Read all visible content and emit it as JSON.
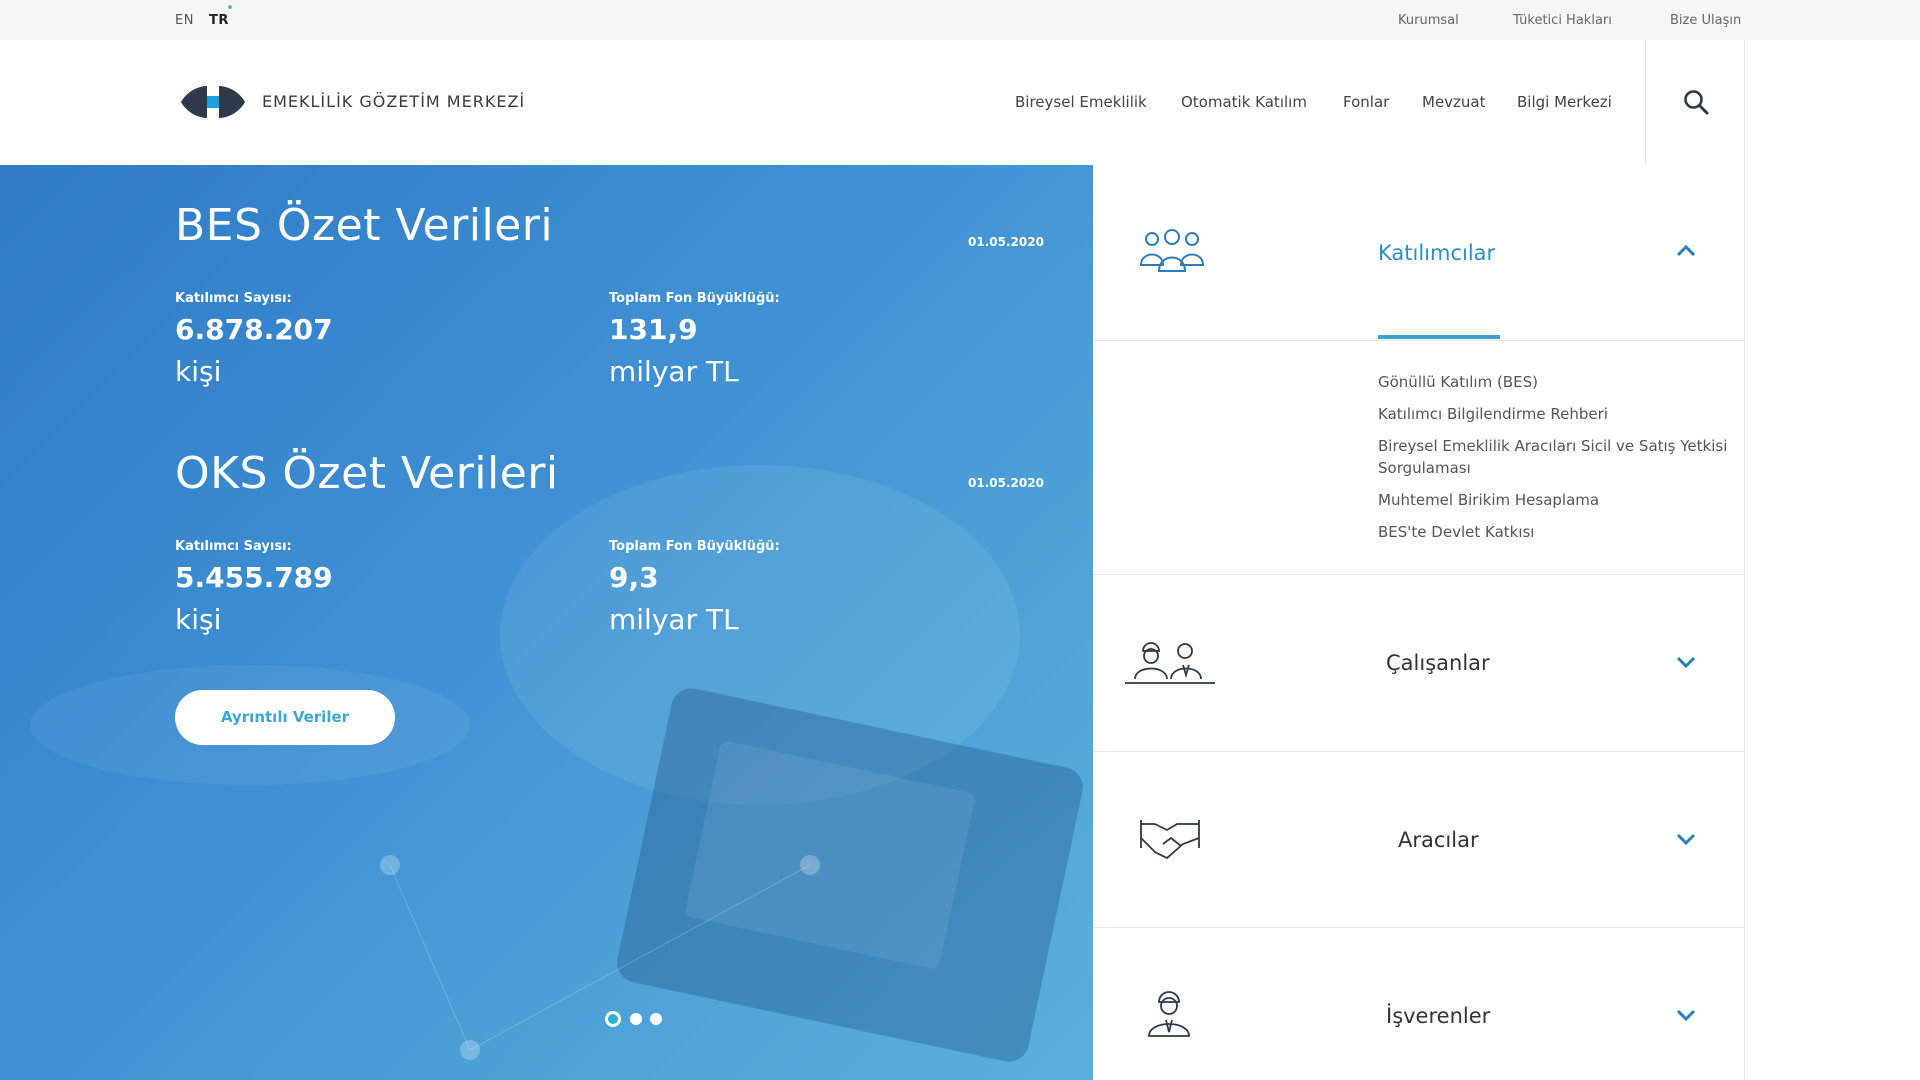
{
  "topbar": {
    "lang_en": "EN",
    "lang_tr": "TR",
    "links": [
      "Kurumsal",
      "Tüketici Hakları",
      "Bize Ulaşın"
    ]
  },
  "header": {
    "brand": "EMEKLİLİK GÖZETİM MERKEZİ",
    "nav": [
      "Bireysel Emeklilik",
      "Otomatik Katılım",
      "Fonlar",
      "Mevzuat",
      "Bilgi Merkezi"
    ],
    "search_icon": "search-icon"
  },
  "hero": {
    "bes": {
      "title": "BES Özet Verileri",
      "date": "01.05.2020",
      "participants_label": "Katılımcı Sayısı:",
      "participants_value": "6.878.207",
      "participants_unit": "kişi",
      "fund_label": "Toplam Fon Büyüklüğü:",
      "fund_value": "131,9",
      "fund_unit": "milyar TL"
    },
    "oks": {
      "title": "OKS Özet Verileri",
      "date": "01.05.2020",
      "participants_label": "Katılımcı Sayısı:",
      "participants_value": "5.455.789",
      "participants_unit": "kişi",
      "fund_label": "Toplam Fon Büyüklüğü:",
      "fund_value": "9,3",
      "fund_unit": "milyar TL"
    },
    "button": "Ayrıntılı Veriler",
    "slide_active": 1,
    "slide_count": 3
  },
  "accordion": [
    {
      "title": "Katılımcılar",
      "icon": "people-group-icon",
      "expanded": true,
      "links": [
        "Gönüllü Katılım (BES)",
        "Katılımcı Bilgilendirme Rehberi",
        "Bireysel Emeklilik Aracıları Sicil ve Satış Yetkisi Sorgulaması",
        "Muhtemel Birikim Hesaplama",
        "BES'te Devlet Katkısı"
      ]
    },
    {
      "title": "Çalışanlar",
      "icon": "workers-icon",
      "expanded": false
    },
    {
      "title": "Aracılar",
      "icon": "handshake-icon",
      "expanded": false
    },
    {
      "title": "İşverenler",
      "icon": "businessman-icon",
      "expanded": false
    }
  ],
  "colors": {
    "accent": "#2b8fc4",
    "hero_blue": "#3d8ed2",
    "teal": "#3aa9cf"
  }
}
